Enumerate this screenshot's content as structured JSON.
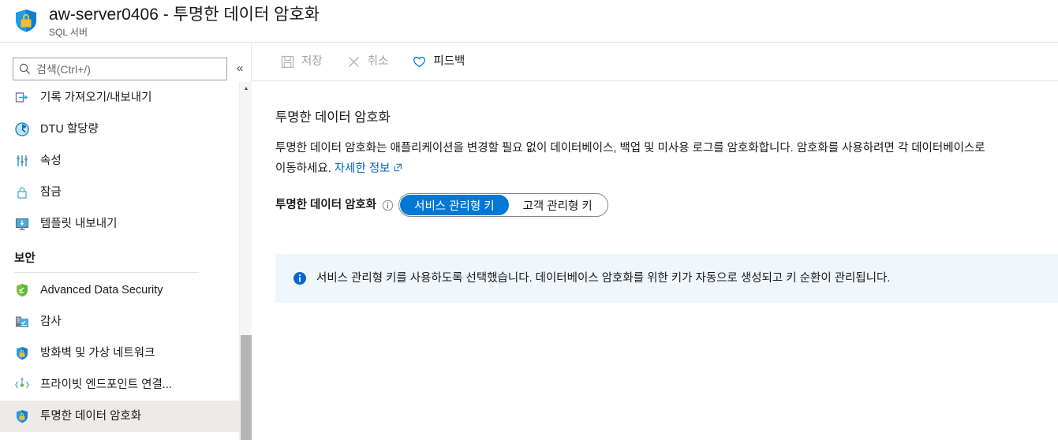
{
  "header": {
    "title": "aw-server0406 - 투명한 데이터 암호화",
    "subtitle": "SQL 서버",
    "icon": "shield-lock-icon"
  },
  "search": {
    "placeholder": "검색(Ctrl+/)",
    "value": "",
    "icon": "search-icon",
    "collapse_label": "«"
  },
  "sidebar": {
    "items": [
      {
        "label": "기록 가져오기/내보내기",
        "icon": "import-export-icon",
        "selected": false
      },
      {
        "label": "DTU 할당량",
        "icon": "dtu-quota-icon",
        "selected": false
      },
      {
        "label": "속성",
        "icon": "properties-icon",
        "selected": false
      },
      {
        "label": "잠금",
        "icon": "lock-icon",
        "selected": false
      },
      {
        "label": "템플릿 내보내기",
        "icon": "export-template-icon",
        "selected": false
      }
    ],
    "section": {
      "title": "보안",
      "items": [
        {
          "label": "Advanced Data Security",
          "icon": "advanced-data-security-icon",
          "selected": false
        },
        {
          "label": "감사",
          "icon": "auditing-icon",
          "selected": false
        },
        {
          "label": "방화벽 및 가상 네트워크",
          "icon": "firewall-icon",
          "selected": false
        },
        {
          "label": "프라이빗 엔드포인트 연결...",
          "icon": "private-endpoint-icon",
          "selected": false
        },
        {
          "label": "투명한 데이터 암호화",
          "icon": "tde-shield-icon",
          "selected": true
        }
      ]
    }
  },
  "toolbar": {
    "save_label": "저장",
    "save_icon": "save-icon",
    "save_disabled": true,
    "cancel_label": "취소",
    "cancel_icon": "cancel-icon",
    "cancel_disabled": true,
    "feedback_label": "피드백",
    "feedback_icon": "heart-icon"
  },
  "content": {
    "title": "투명한 데이터 암호화",
    "description_line1": "투명한 데이터 암호화는 애플리케이션을 변경할 필요 없이 데이터베이스, 백업 및 미사용 로그를 암호화합니다. 암호화를",
    "description_line2": "사용하려면 각 데이터베이스로 이동하세요.",
    "learn_more_label": "자세한 정보",
    "learn_more_icon": "external-link-icon",
    "field": {
      "label": "투명한 데이터 암호화",
      "info_icon": "info-circle-icon",
      "options": [
        {
          "label": "서비스 관리형 키",
          "selected": true
        },
        {
          "label": "고객 관리형 키",
          "selected": false
        }
      ]
    },
    "banner": {
      "icon": "info-filled-icon",
      "text": "서비스 관리형 키를 사용하도록 선택했습니다. 데이터베이스 암호화를 위한 키가 자동으로 생성되고 키 순환이 관리됩니다."
    }
  },
  "colors": {
    "accent": "#0078d4",
    "link": "#0066c0",
    "banner_bg": "#eff6fc",
    "selected_nav_bg": "#edebe9",
    "shield_blue": "#0d7fdb",
    "lock_gold": "#f5be2b",
    "green_shield": "#5cb832"
  },
  "scrollbar": {
    "up_arrow": "▲"
  }
}
